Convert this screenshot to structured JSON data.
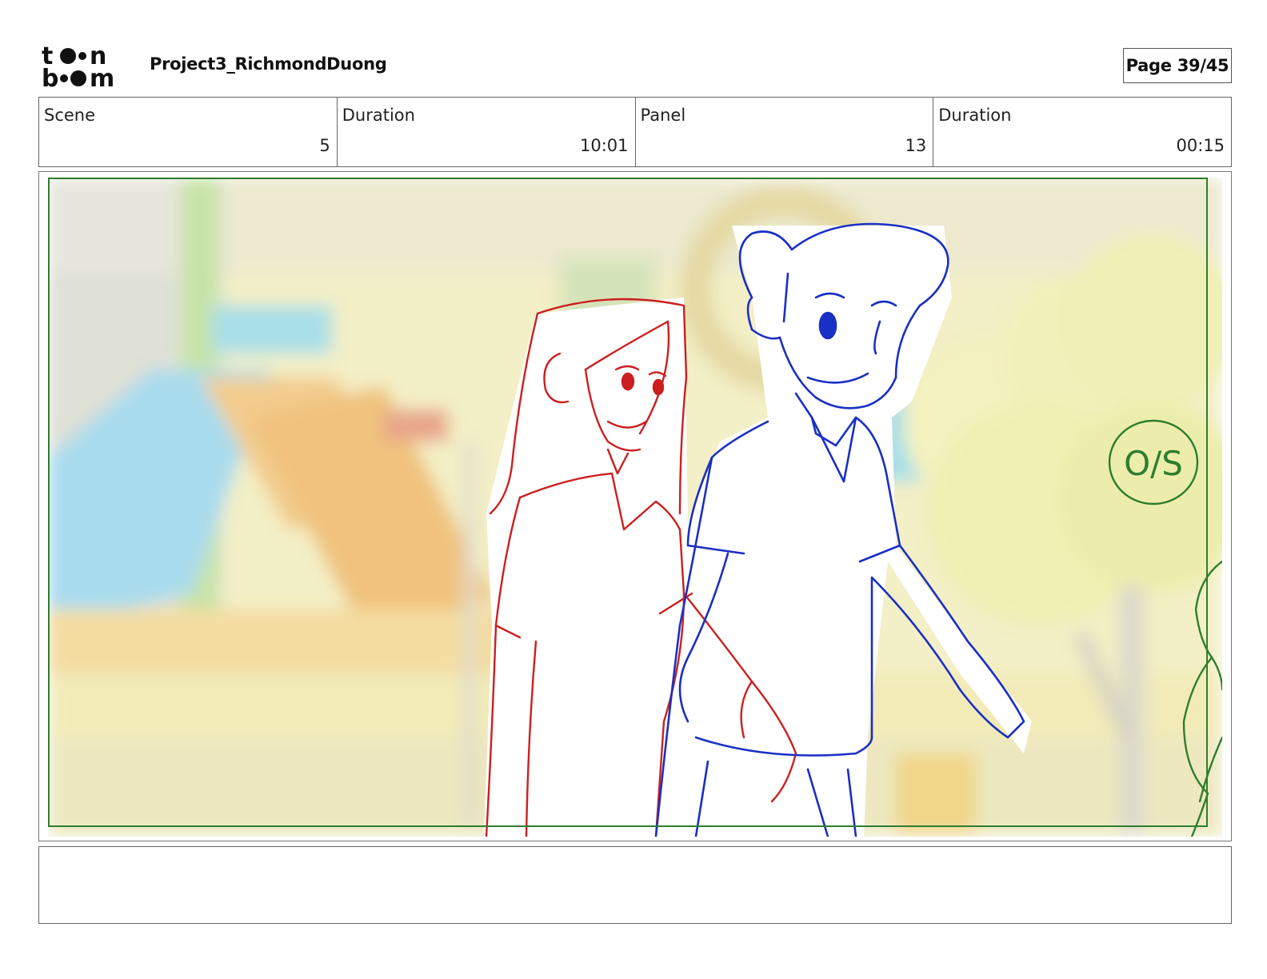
{
  "header": {
    "logo_text": "toon boom",
    "project_title": "Project3_RichmondDuong",
    "page_label": "Page 39/45"
  },
  "info": {
    "scene_label": "Scene",
    "scene_value": "5",
    "scene_duration_label": "Duration",
    "scene_duration_value": "10:01",
    "panel_label": "Panel",
    "panel_value": "13",
    "panel_duration_label": "Duration",
    "panel_duration_value": "00:15"
  },
  "panel": {
    "shot_note": "O/S",
    "colors": {
      "frame": "#2e7d2e",
      "girl_sketch": "#cc1f1f",
      "boy_sketch": "#1a2fc4",
      "offscreen_sketch": "#2e7d2e"
    }
  },
  "notes": {
    "action_text": ""
  }
}
